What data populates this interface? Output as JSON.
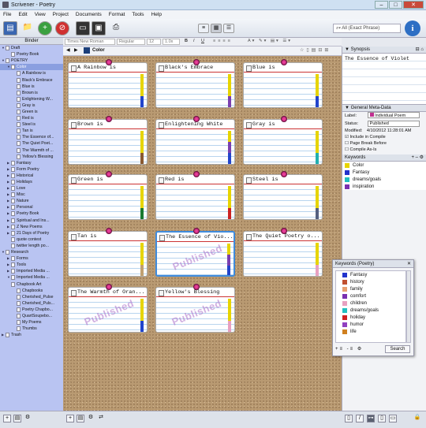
{
  "window": {
    "title": "Scrivener - Poetry"
  },
  "menu": [
    "File",
    "Edit",
    "View",
    "Project",
    "Documents",
    "Format",
    "Tools",
    "Help"
  ],
  "search": {
    "placeholder": "All (Exact Phrase)"
  },
  "binder": {
    "header": "Binder",
    "items": [
      {
        "label": "Draft",
        "depth": 0,
        "tri": "▼"
      },
      {
        "label": "Poetry Book",
        "depth": 1,
        "tri": ""
      },
      {
        "label": "POETRY",
        "depth": 0,
        "tri": "▼"
      },
      {
        "label": "Color",
        "depth": 1,
        "tri": "▼",
        "selected": true
      },
      {
        "label": "A Rainbow is",
        "depth": 2,
        "tri": ""
      },
      {
        "label": "Black's Embrace",
        "depth": 2,
        "tri": ""
      },
      {
        "label": "Blue is",
        "depth": 2,
        "tri": ""
      },
      {
        "label": "Brown is",
        "depth": 2,
        "tri": ""
      },
      {
        "label": "Enlightening W...",
        "depth": 2,
        "tri": ""
      },
      {
        "label": "Gray is",
        "depth": 2,
        "tri": ""
      },
      {
        "label": "Green is",
        "depth": 2,
        "tri": ""
      },
      {
        "label": "Red is",
        "depth": 2,
        "tri": ""
      },
      {
        "label": "Steel is",
        "depth": 2,
        "tri": ""
      },
      {
        "label": "Tan is",
        "depth": 2,
        "tri": ""
      },
      {
        "label": "The Essence of...",
        "depth": 2,
        "tri": ""
      },
      {
        "label": "The Quiet Poet...",
        "depth": 2,
        "tri": ""
      },
      {
        "label": "The Warmth of ...",
        "depth": 2,
        "tri": ""
      },
      {
        "label": "Yellow's Blessing",
        "depth": 2,
        "tri": ""
      },
      {
        "label": "Fantasy",
        "depth": 1,
        "tri": "▶"
      },
      {
        "label": "Form Poetry",
        "depth": 1,
        "tri": "▶"
      },
      {
        "label": "Historical",
        "depth": 1,
        "tri": "▶"
      },
      {
        "label": "Holidays",
        "depth": 1,
        "tri": "▶"
      },
      {
        "label": "Love",
        "depth": 1,
        "tri": "▶"
      },
      {
        "label": "Misc",
        "depth": 1,
        "tri": "▶"
      },
      {
        "label": "Nature",
        "depth": 1,
        "tri": "▶"
      },
      {
        "label": "Personal",
        "depth": 1,
        "tri": "▶"
      },
      {
        "label": "Poetry Book",
        "depth": 1,
        "tri": "▶"
      },
      {
        "label": "Spiritual and Ins...",
        "depth": 1,
        "tri": "▶"
      },
      {
        "label": "Z New Poems",
        "depth": 1,
        "tri": "▶"
      },
      {
        "label": "21 Days of Poetry",
        "depth": 1,
        "tri": "▶"
      },
      {
        "label": "quote contest",
        "depth": 1,
        "tri": ""
      },
      {
        "label": "twitter length po...",
        "depth": 1,
        "tri": ""
      },
      {
        "label": "Research",
        "depth": 0,
        "tri": "▼"
      },
      {
        "label": "Forms",
        "depth": 1,
        "tri": "▶"
      },
      {
        "label": "Tools",
        "depth": 1,
        "tri": "▶"
      },
      {
        "label": "Imported Media ...",
        "depth": 1,
        "tri": "▶"
      },
      {
        "label": "Imported Media ...",
        "depth": 1,
        "tri": "▼"
      },
      {
        "label": "Chapbook Art",
        "depth": 1,
        "tri": ""
      },
      {
        "label": "Chapbooks",
        "depth": 2,
        "tri": ""
      },
      {
        "label": "Cherished_Pulse",
        "depth": 2,
        "tri": ""
      },
      {
        "label": "Cherished_Puls...",
        "depth": 2,
        "tri": ""
      },
      {
        "label": "Poetry Chapbo...",
        "depth": 2,
        "tri": ""
      },
      {
        "label": "QuartSoupebo...",
        "depth": 2,
        "tri": ""
      },
      {
        "label": "My Poems",
        "depth": 2,
        "tri": ""
      },
      {
        "label": "Thumbs",
        "depth": 2,
        "tri": ""
      },
      {
        "label": "Trash",
        "depth": 0,
        "tri": "▶"
      }
    ]
  },
  "formatbar": {
    "font": "Times New Roman",
    "style": "Regular",
    "size": "12",
    "spacing": "1.0x"
  },
  "navbar": {
    "title": "Color"
  },
  "cards": [
    {
      "title": "A Rainbow is",
      "stripes": [
        "#e6d400",
        "#e6d400",
        "#2244cc"
      ],
      "stamp": ""
    },
    {
      "title": "Black's Embrace",
      "stripes": [
        "#e6d400",
        "#e6d400",
        "#7a40b0"
      ],
      "stamp": ""
    },
    {
      "title": "Blue is",
      "stripes": [
        "#e6d400",
        "#e6d400",
        "#2244cc"
      ],
      "stamp": ""
    },
    {
      "title": "Brown is",
      "stripes": [
        "#e6d400",
        "#e6d400",
        "#8a5a30"
      ],
      "stamp": ""
    },
    {
      "title": "Enlightening White",
      "stripes": [
        "#e6d400",
        "#7a40b0",
        "#2244cc"
      ],
      "stamp": ""
    },
    {
      "title": "Gray is",
      "stripes": [
        "#e6d400",
        "#e6d400",
        "#22b0b0"
      ],
      "stamp": ""
    },
    {
      "title": "Green is",
      "stripes": [
        "#e6d400",
        "#e6d400",
        "#1a7a30"
      ],
      "stamp": ""
    },
    {
      "title": "Red is",
      "stripes": [
        "#e6d400",
        "#e6d400",
        "#cc2222"
      ],
      "stamp": ""
    },
    {
      "title": "Steel is",
      "stripes": [
        "#e6d400",
        "#e6d400",
        "#556080"
      ],
      "stamp": ""
    },
    {
      "title": "Tan is",
      "stripes": [
        "#e6d400",
        "#e6d400",
        "#c0a070"
      ],
      "stamp": ""
    },
    {
      "title": "The Essence of Vio...",
      "stripes": [
        "#e6d400",
        "#7a40b0",
        "#2244cc"
      ],
      "stamp": "Published"
    },
    {
      "title": "The Quiet Poetry o...",
      "stripes": [
        "#e6d400",
        "#e6d400",
        "#e8a0c0"
      ],
      "stamp": ""
    },
    {
      "title": "The Warmth of Oran...",
      "stripes": [
        "#e6d400",
        "#e6d400",
        "#2244cc"
      ],
      "stamp": "Published"
    },
    {
      "title": "Yellow's Blessing",
      "stripes": [
        "#e6d400",
        "#e6d400",
        "#e8a0c0"
      ],
      "stamp": "Published"
    }
  ],
  "inspector": {
    "synopsis_header": "Synopsis",
    "synopsis_text": "The Essence of Violet",
    "meta_header": "General Meta-Data",
    "label_label": "Label:",
    "label_value": "Individual Poem",
    "status_label": "Status:",
    "status_value": "Published",
    "modified_label": "Modified:",
    "modified_value": "4/10/2012 11:28:01 AM",
    "include": "Include in Compile",
    "pagebreak": "Page Break Before",
    "compileas": "Compile As-Is",
    "keywords_header": "Keywords",
    "keywords": [
      {
        "name": "Color",
        "color": "#e6d400"
      },
      {
        "name": "Fantasy",
        "color": "#2233cc"
      },
      {
        "name": "dreams/goals",
        "color": "#22c0c0"
      },
      {
        "name": "inspiration",
        "color": "#7a30b0"
      }
    ]
  },
  "kwpanel": {
    "title": "Keywords (Poetry)",
    "items": [
      {
        "name": "Fantasy",
        "color": "#2233cc"
      },
      {
        "name": "history",
        "color": "#c05030"
      },
      {
        "name": "family",
        "color": "#e8a070"
      },
      {
        "name": "comfort",
        "color": "#7a30b0"
      },
      {
        "name": "children",
        "color": "#e8a0c0"
      },
      {
        "name": "dreams/goals",
        "color": "#22c0c0"
      },
      {
        "name": "holiday",
        "color": "#d02020"
      },
      {
        "name": "humor",
        "color": "#9040c0"
      },
      {
        "name": "life",
        "color": "#d08020"
      }
    ],
    "search_label": "Search"
  }
}
